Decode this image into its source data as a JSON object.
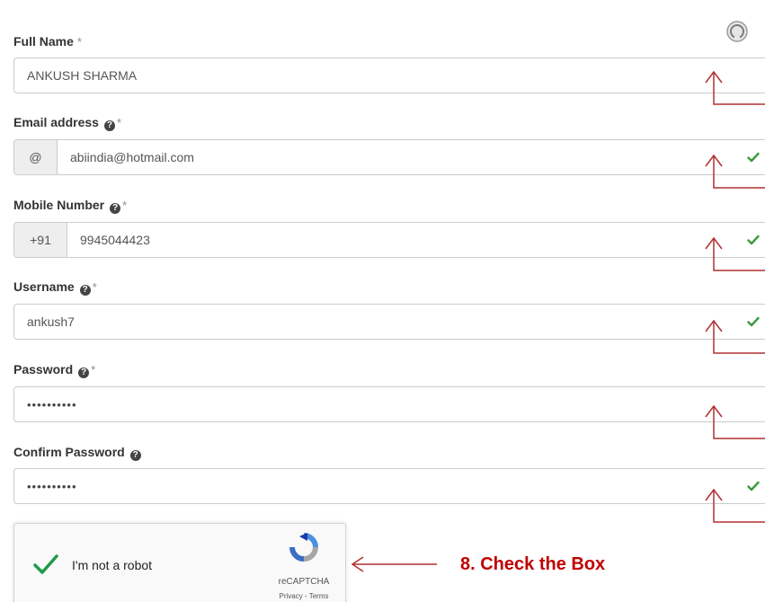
{
  "form": {
    "full_name": {
      "label": "Full Name",
      "required_mark": "*",
      "value": "ANKUSH SHARMA"
    },
    "email": {
      "label": "Email address",
      "help_icon": "?",
      "required_mark": "*",
      "addon": "@",
      "value": "abiindia@hotmail.com",
      "valid": true
    },
    "mobile": {
      "label": "Mobile Number",
      "help_icon": "?",
      "required_mark": "*",
      "addon": "+91",
      "value": "9945044423",
      "valid": true
    },
    "username": {
      "label": "Username",
      "help_icon": "?",
      "required_mark": "*",
      "value": "ankush7",
      "valid": true
    },
    "password": {
      "label": "Password",
      "help_icon": "?",
      "required_mark": "*",
      "value": "••••••••••"
    },
    "confirm_password": {
      "label": "Confirm Password",
      "help_icon": "?",
      "value": "••••••••••",
      "valid": true
    }
  },
  "recaptcha": {
    "label": "I'm not a robot",
    "brand": "reCAPTCHA",
    "privacy": "Privacy",
    "separator": " - ",
    "terms": "Terms",
    "checked": true
  },
  "annotation": {
    "step_text": "8. Check the Box",
    "color": "#c00000"
  },
  "colors": {
    "valid_check": "#3c9a3c",
    "annotation_arrow": "#b03030",
    "recaptcha_blue": "#4a90e2",
    "recaptcha_gray": "#a6a6a6",
    "recaptcha_tick": "#1f9a48"
  },
  "icons": {
    "top_right": "user-avatar-icon",
    "help": "question-circle-icon",
    "valid": "check-icon"
  }
}
